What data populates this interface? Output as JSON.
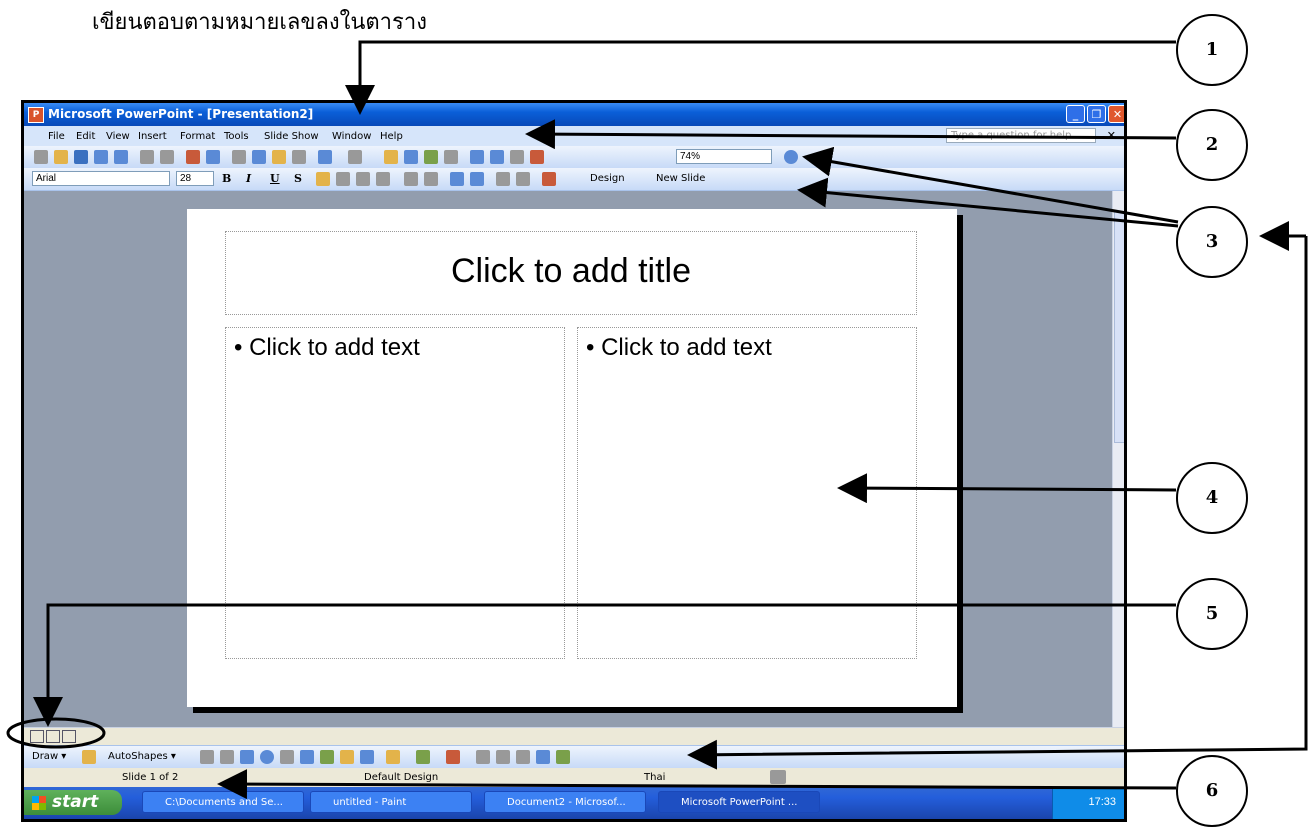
{
  "instruction": "เขียนตอบตามหมายเลขลงในตาราง",
  "window": {
    "title": "Microsoft PowerPoint - [Presentation2]",
    "controls": [
      "_",
      "❐",
      "✕"
    ]
  },
  "menubar": {
    "items": [
      "File",
      "Edit",
      "View",
      "Insert",
      "Format",
      "Tools",
      "Slide Show",
      "Window",
      "Help"
    ],
    "help_placeholder": "Type a question for help",
    "close": "✕"
  },
  "standard_toolbar": {
    "zoom": "74%"
  },
  "formatting_toolbar": {
    "font": "Arial",
    "size": "28",
    "bold": "B",
    "italic": "I",
    "underline": "U",
    "shadow": "S",
    "design_label": "Design",
    "new_slide_label": "New Slide"
  },
  "slide": {
    "title_placeholder": "Click to add title",
    "left_body": "• Click to add text",
    "right_body": "• Click to add text"
  },
  "drawbar": {
    "draw_label": "Draw ▾",
    "autoshapes_label": "AutoShapes ▾"
  },
  "statusbar": {
    "slide_info": "Slide 1 of 2",
    "design": "Default Design",
    "language": "Thai"
  },
  "taskbar": {
    "start_label": "start",
    "tasks": [
      "C:\\Documents and Se...",
      "untitled - Paint",
      "Document2 - Microsof...",
      "Microsoft PowerPoint ..."
    ],
    "clock": "17:33"
  },
  "callouts": [
    "1",
    "2",
    "3",
    "4",
    "5",
    "6"
  ]
}
